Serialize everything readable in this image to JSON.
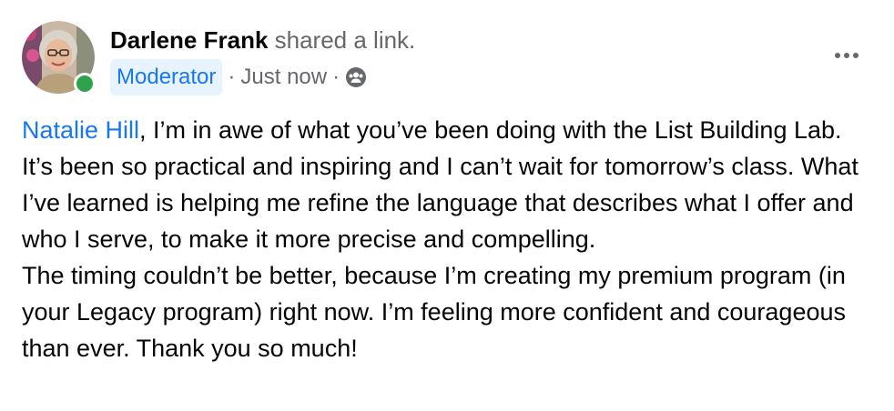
{
  "author": {
    "name": "Darlene Frank",
    "action": "shared a link."
  },
  "meta": {
    "badge": "Moderator",
    "separator": "·",
    "timestamp": "Just now",
    "audience_icon": "group-icon"
  },
  "post": {
    "mention": "Natalie Hill",
    "paragraph1_rest": ", I’m in awe of what you’ve been doing with the List Building Lab. It’s been so practical and inspiring and I can’t wait for tomorrow’s class. What I’ve learned is helping me refine the language that describes what I offer and who I serve, to make it more precise and compelling.",
    "paragraph2": "The timing couldn’t be better, because I’m creating my premium program (in your Legacy program) right now. I’m feeling more confident and courageous than ever. Thank you so much!"
  },
  "colors": {
    "link": "#1877f2",
    "secondary_text": "#65676b",
    "online": "#31a24c",
    "badge_bg": "#e7f3ff"
  }
}
